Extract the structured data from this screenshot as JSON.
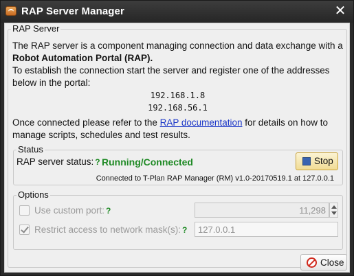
{
  "window": {
    "title": "RAP Server Manager",
    "icon": "rap-app-icon",
    "close_glyph": "✕"
  },
  "server_group": {
    "legend": "RAP Server",
    "intro_line1": "The RAP server is a component managing connection and data exchange with a",
    "intro_line2": "Robot Automation Portal (RAP).",
    "instruction_line1": "To establish the connection start the server and register one of the addresses",
    "instruction_line2": "below in the portal:",
    "addresses": [
      "192.168.1.8",
      "192.168.56.1"
    ],
    "doc_prefix": "Once connected please refer to the ",
    "doc_link": "RAP documentation",
    "doc_suffix": " for details on how to",
    "doc_line2": "manage scripts, schedules and test results."
  },
  "status_group": {
    "legend": "Status",
    "status_label": "RAP server status:",
    "help_mark": "?",
    "status_value": "Running/Connected",
    "status_color": "#1f8a25",
    "stop_button": "Stop",
    "connection_info": "Connected to T-Plan RAP Manager (RM) v1.0-20170519.1 at 127.0.0.1"
  },
  "options_group": {
    "legend": "Options",
    "custom_port_label": "Use custom port:",
    "custom_port_checked": false,
    "custom_port_value": "11,298",
    "restrict_label": "Restrict access to network mask(s):",
    "restrict_checked": true,
    "mask_value": "127.0.0.1",
    "help_mark": "?"
  },
  "footer": {
    "close_button": "Close"
  }
}
